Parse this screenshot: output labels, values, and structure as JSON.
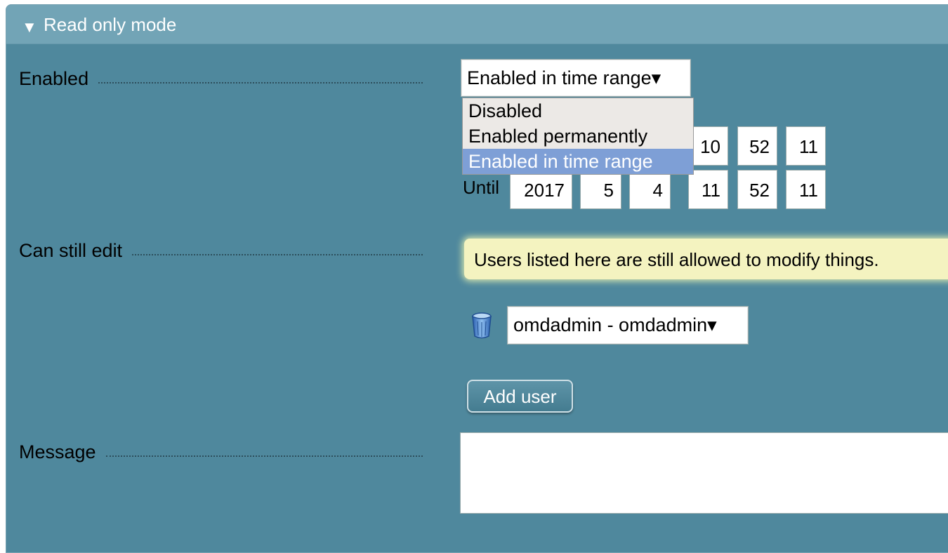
{
  "header": {
    "title": "Read only mode"
  },
  "fields": {
    "enabled_label": "Enabled",
    "can_still_edit_label": "Can still edit",
    "message_label": "Message"
  },
  "enabled_select": {
    "value": "Enabled in time range▾",
    "options": [
      "Disabled",
      "Enabled permanently",
      "Enabled in time range"
    ]
  },
  "from_time": {
    "hour": "10",
    "minute": "52",
    "second": "11"
  },
  "until": {
    "label": "Until",
    "year": "2017",
    "month": "5",
    "day": "4",
    "hour": "11",
    "minute": "52",
    "second": "11"
  },
  "help_text": "Users listed here are still allowed to modify things.",
  "user_select": {
    "value": "omdadmin - omdadmin▾"
  },
  "add_user_button": "Add user",
  "message": {
    "value": ""
  },
  "colors": {
    "panel_bg": "#4f889d",
    "header_bg": "#72a4b6",
    "selected_option": "#7e9fd6",
    "help_bg": "#f4f3c0"
  }
}
